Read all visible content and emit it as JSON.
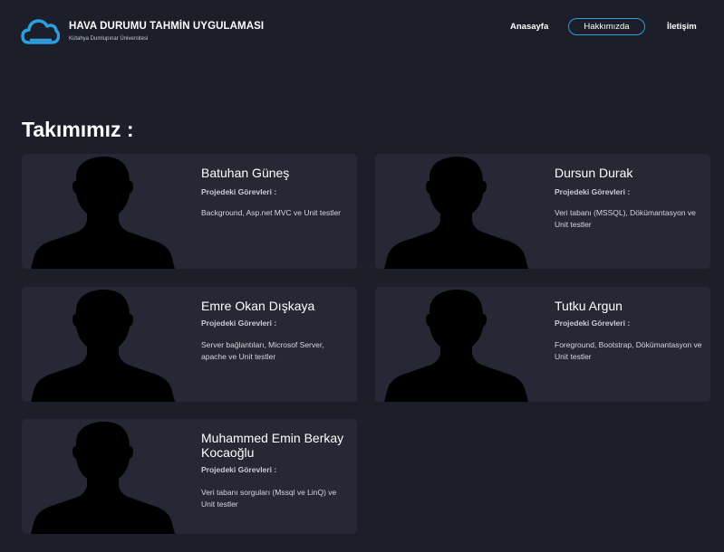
{
  "header": {
    "title": "HAVA DURUMU TAHMİN UYGULAMASI",
    "subtitle": "Kütahya Dumlupınar Üniversitesi",
    "nav": {
      "home": "Anasayfa",
      "about": "Hakkımızda",
      "contact": "İletişim"
    },
    "logo_icon": "cloud-icon",
    "accent_color": "#2d9ee0"
  },
  "main": {
    "section_title": "Takımımız :",
    "members": [
      {
        "name": "Batuhan Güneş",
        "role_label": "Projedeki Görevleri :",
        "role": "Background, Asp.net MVC ve Unit testler"
      },
      {
        "name": "Dursun Durak",
        "role_label": "Projedeki Görevleri :",
        "role": "Veri tabanı (MSSQL), Dökümantasyon ve Unit testler"
      },
      {
        "name": "Emre Okan Dışkaya",
        "role_label": "Projedeki Görevleri :",
        "role": "Server bağlantıları, Microsof Server, apache ve Unit testler"
      },
      {
        "name": "Tutku Argun",
        "role_label": "Projedeki Görevleri :",
        "role": "Foreground, Bootstrap, Dökümantasyon ve Unit testler"
      },
      {
        "name": "Muhammed Emin Berkay Kocaoğlu",
        "role_label": "Projedeki Görevleri :",
        "role": "Veri tabanı sorguları (Mssql ve LinQ) ve Unit testler"
      }
    ]
  }
}
